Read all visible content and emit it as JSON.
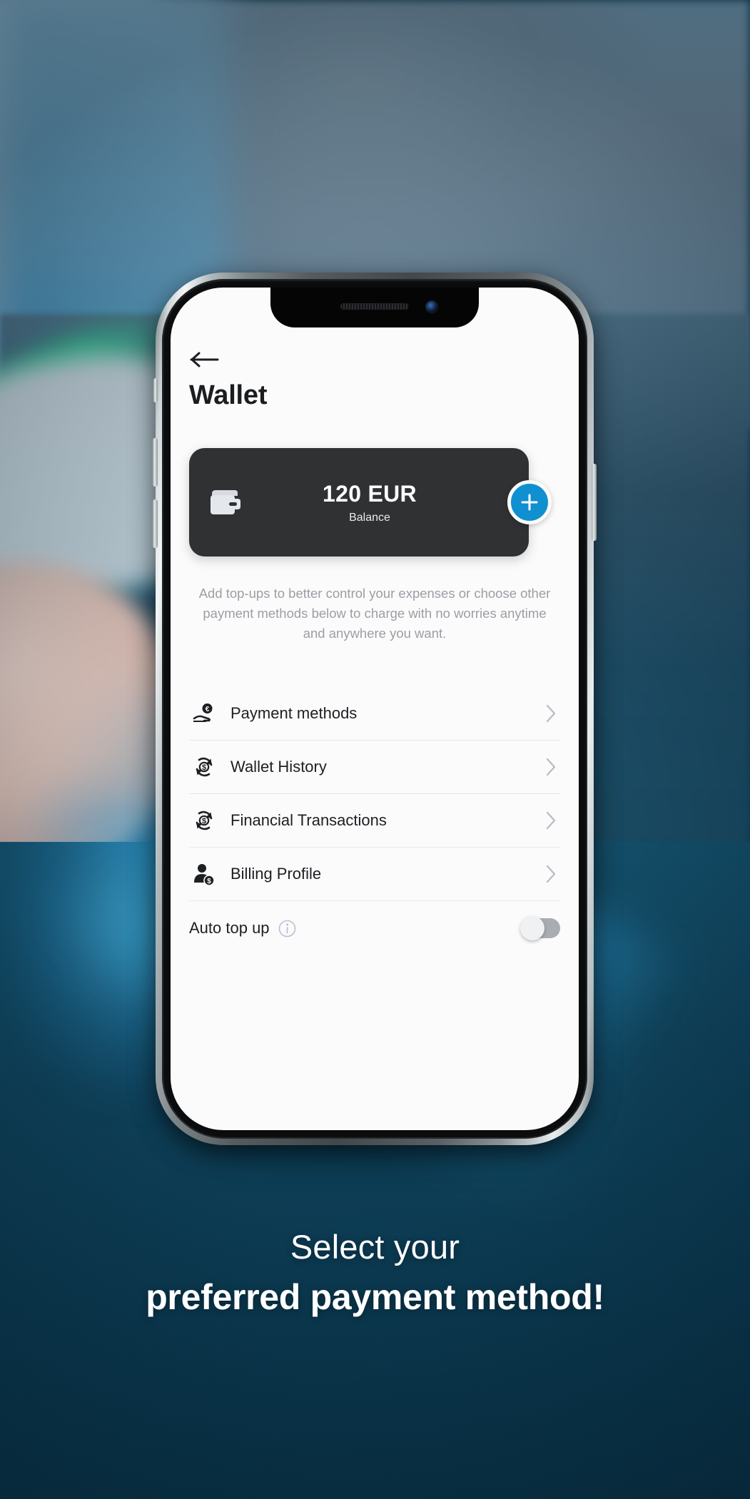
{
  "screen": {
    "back_icon": "arrow-left-icon",
    "title": "Wallet"
  },
  "balance_card": {
    "wallet_icon": "wallet-icon",
    "amount": "120 EUR",
    "label": "Balance",
    "add_button_icon": "plus-icon",
    "accent_color": "#1090d0",
    "card_color": "#2f3133"
  },
  "description": "Add top-ups to better control your expenses or choose other payment methods below to charge with no worries anytime and anywhere you want.",
  "menu": {
    "items": [
      {
        "label": "Payment methods",
        "icon": "hand-euro-coin-icon",
        "chevron": "chevron-right-icon"
      },
      {
        "label": "Wallet History",
        "icon": "refresh-dollar-icon",
        "chevron": "chevron-right-icon"
      },
      {
        "label": "Financial Transactions",
        "icon": "refresh-dollar-icon",
        "chevron": "chevron-right-icon"
      },
      {
        "label": "Billing Profile",
        "icon": "person-dollar-icon",
        "chevron": "chevron-right-icon"
      }
    ]
  },
  "auto_top_up": {
    "label": "Auto top up",
    "info_icon": "info-icon",
    "toggle_state": "off"
  },
  "caption": {
    "line1": "Select your",
    "line2": "preferred payment method!"
  }
}
